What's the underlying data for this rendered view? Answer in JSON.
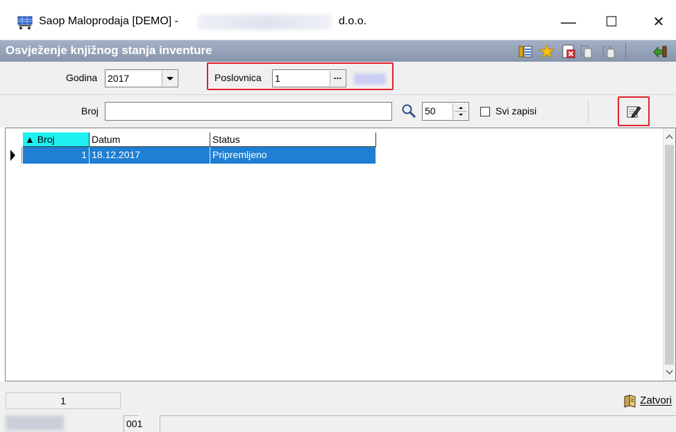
{
  "window": {
    "title": "Saop Maloprodaja [DEMO] -",
    "title_suffix": "d.o.o.",
    "minimize": "—",
    "maximize": "☐",
    "close": "✕"
  },
  "header": {
    "title": "Osvježenje knjižnog stanja inventure",
    "icons": [
      "layout-icon",
      "star-icon",
      "delete-icon",
      "copy-icon",
      "paste-icon",
      "exit-icon"
    ]
  },
  "filters": {
    "godina_label": "Godina",
    "godina_value": "2017",
    "poslovnica_label": "Poslovnica",
    "poslovnica_value": "1",
    "ellipsis": "..."
  },
  "search": {
    "broj_label": "Broj",
    "broj_value": "",
    "limit_value": "50",
    "svi_zapisi_label": "Svi zapisi"
  },
  "grid": {
    "columns": [
      "▲ Broj",
      "Datum",
      "Status"
    ],
    "rows": [
      {
        "broj": "1",
        "datum": "18.12.2017",
        "status": "Pripremljeno"
      }
    ]
  },
  "footer": {
    "count": "1",
    "close_label": "Zatvori",
    "status_code": "001"
  },
  "colors": {
    "header_band": "#95a2b8",
    "selection": "#1e7fd3",
    "highlight_border": "#e0202a"
  }
}
